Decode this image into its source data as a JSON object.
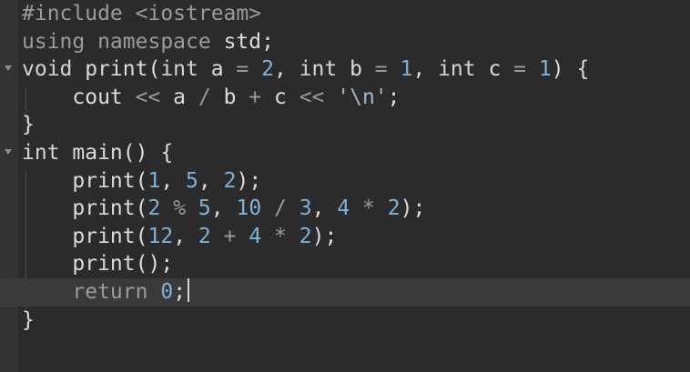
{
  "editor": {
    "lines": [
      {
        "tokens": [
          [
            "dir",
            "#include <iostream>"
          ]
        ]
      },
      {
        "tokens": [
          [
            "dir",
            "using namespace "
          ],
          [
            "plain",
            "std;"
          ]
        ]
      },
      {
        "fold": true,
        "tokens": [
          [
            "kw",
            "void"
          ],
          [
            "plain",
            " print("
          ],
          [
            "kw",
            "int"
          ],
          [
            "plain",
            " a "
          ],
          [
            "op",
            "="
          ],
          [
            "plain",
            " "
          ],
          [
            "num",
            "2"
          ],
          [
            "plain",
            ", "
          ],
          [
            "kw",
            "int"
          ],
          [
            "plain",
            " b "
          ],
          [
            "op",
            "="
          ],
          [
            "plain",
            " "
          ],
          [
            "num",
            "1"
          ],
          [
            "plain",
            ", "
          ],
          [
            "kw",
            "int"
          ],
          [
            "plain",
            " c "
          ],
          [
            "op",
            "="
          ],
          [
            "plain",
            " "
          ],
          [
            "num",
            "1"
          ],
          [
            "plain",
            ") {"
          ]
        ]
      },
      {
        "tokens": [
          [
            "plain",
            "    cout "
          ],
          [
            "op",
            "<<"
          ],
          [
            "plain",
            " a "
          ],
          [
            "op",
            "/"
          ],
          [
            "plain",
            " b "
          ],
          [
            "op",
            "+"
          ],
          [
            "plain",
            " c "
          ],
          [
            "op",
            "<<"
          ],
          [
            "plain",
            " "
          ],
          [
            "str",
            "'\\n'"
          ],
          [
            "plain",
            ";"
          ]
        ]
      },
      {
        "tokens": [
          [
            "plain",
            "}"
          ]
        ]
      },
      {
        "fold": true,
        "tokens": [
          [
            "kw",
            "int"
          ],
          [
            "plain",
            " main() {"
          ]
        ]
      },
      {
        "tokens": [
          [
            "plain",
            "    print("
          ],
          [
            "num",
            "1"
          ],
          [
            "plain",
            ", "
          ],
          [
            "num",
            "5"
          ],
          [
            "plain",
            ", "
          ],
          [
            "num",
            "2"
          ],
          [
            "plain",
            ");"
          ]
        ]
      },
      {
        "tokens": [
          [
            "plain",
            "    print("
          ],
          [
            "num",
            "2"
          ],
          [
            "plain",
            " "
          ],
          [
            "op",
            "%"
          ],
          [
            "plain",
            " "
          ],
          [
            "num",
            "5"
          ],
          [
            "plain",
            ", "
          ],
          [
            "num",
            "10"
          ],
          [
            "plain",
            " "
          ],
          [
            "op",
            "/"
          ],
          [
            "plain",
            " "
          ],
          [
            "num",
            "3"
          ],
          [
            "plain",
            ", "
          ],
          [
            "num",
            "4"
          ],
          [
            "plain",
            " "
          ],
          [
            "op",
            "*"
          ],
          [
            "plain",
            " "
          ],
          [
            "num",
            "2"
          ],
          [
            "plain",
            ");"
          ]
        ]
      },
      {
        "tokens": [
          [
            "plain",
            "    print("
          ],
          [
            "num",
            "12"
          ],
          [
            "plain",
            ", "
          ],
          [
            "num",
            "2"
          ],
          [
            "plain",
            " "
          ],
          [
            "op",
            "+"
          ],
          [
            "plain",
            " "
          ],
          [
            "num",
            "4"
          ],
          [
            "plain",
            " "
          ],
          [
            "op",
            "*"
          ],
          [
            "plain",
            " "
          ],
          [
            "num",
            "2"
          ],
          [
            "plain",
            ");"
          ]
        ]
      },
      {
        "tokens": [
          [
            "plain",
            "    print();"
          ]
        ]
      },
      {
        "current": true,
        "tokens": [
          [
            "plain",
            "    "
          ],
          [
            "dir",
            "return"
          ],
          [
            "plain",
            " "
          ],
          [
            "num",
            "0"
          ],
          [
            "plain",
            ";"
          ]
        ]
      },
      {
        "tokens": [
          [
            "plain",
            "}"
          ]
        ]
      }
    ]
  }
}
